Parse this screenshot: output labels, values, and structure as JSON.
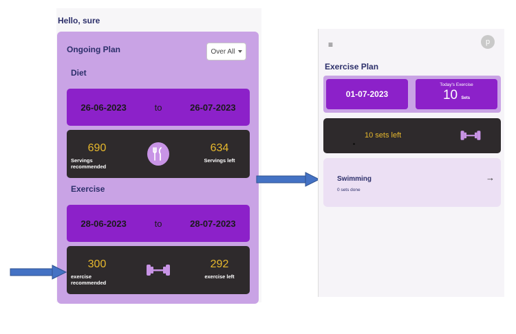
{
  "left_screen": {
    "greeting": "Hello, sure",
    "ongoing_plan": {
      "title": "Ongoing Plan",
      "filter_value": "Over All"
    },
    "diet": {
      "label": "Diet",
      "start_date": "26-06-2023",
      "to": "to",
      "end_date": "26-07-2023",
      "recommended_value": "690",
      "recommended_caption": "Servings recommended",
      "left_value": "634",
      "left_caption": "Servings left",
      "icon": "fork-knife-icon"
    },
    "exercise": {
      "label": "Exercise",
      "start_date": "28-06-2023",
      "to": "to",
      "end_date": "28-07-2023",
      "recommended_value": "300",
      "recommended_caption": "exercise recommended",
      "left_value": "292",
      "left_caption": "exercise left",
      "icon": "dumbbell-icon"
    }
  },
  "right_screen": {
    "menu_icon": "hamburger-menu-icon",
    "avatar_letter": "p",
    "title": "Exercise Plan",
    "date": "01-07-2023",
    "todays_exercise_caption": "Today's Exercise",
    "todays_exercise_value": "10",
    "todays_exercise_unit": "Sets",
    "sets_left_text": "10 sets left",
    "activity": {
      "name": "Swimming",
      "status": "0 sets done",
      "arrow": "→"
    }
  },
  "colors": {
    "plan_card_bg": "#c9a3e5",
    "date_bar_bg": "#8c21c9",
    "stat_bar_bg": "#2e2a2c",
    "stat_number": "#e8b92d",
    "title_text": "#2c2f6a",
    "arrow_blue": "#4472c4"
  }
}
